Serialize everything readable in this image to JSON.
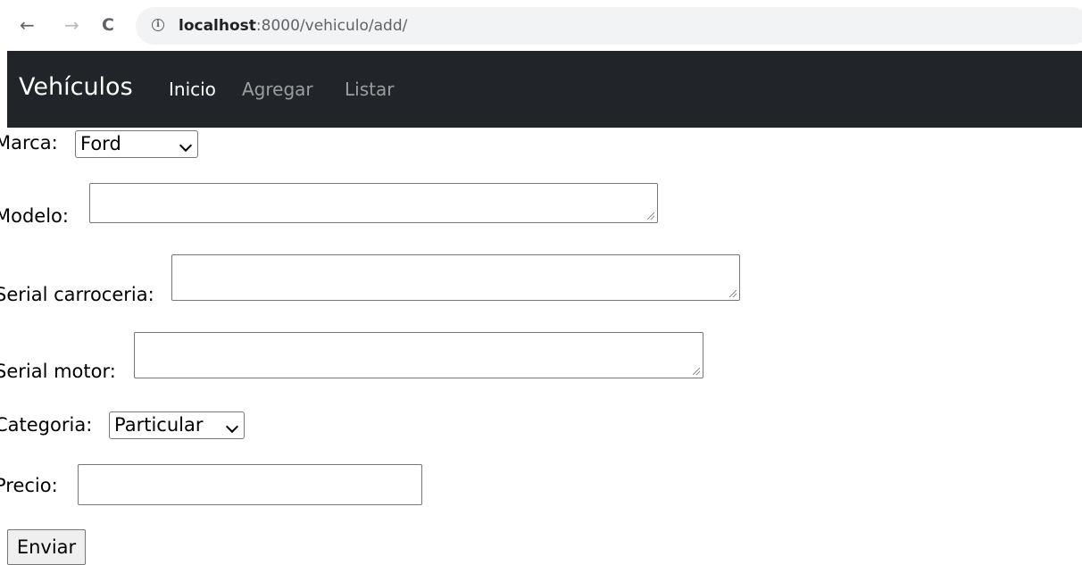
{
  "browser": {
    "back_icon": "←",
    "forward_icon": "→",
    "reload_icon": "C",
    "info_icon": "i",
    "url_host": "localhost",
    "url_path": ":8000/vehiculo/add/"
  },
  "navbar": {
    "brand": "Vehículos",
    "links": [
      {
        "label": "Inicio",
        "active": true
      },
      {
        "label": "Agregar",
        "active": false
      },
      {
        "label": "Listar",
        "active": false
      }
    ],
    "background": "#212529"
  },
  "form": {
    "marca": {
      "label": "Marca:",
      "selected": "Ford"
    },
    "modelo": {
      "label": "Modelo:",
      "value": ""
    },
    "serial_carroceria": {
      "label": "Serial carroceria:",
      "value": ""
    },
    "serial_motor": {
      "label": "Serial motor:",
      "value": ""
    },
    "categoria": {
      "label": "Categoria:",
      "selected": "Particular"
    },
    "precio": {
      "label": "Precio:",
      "value": ""
    },
    "submit_label": "Enviar"
  }
}
